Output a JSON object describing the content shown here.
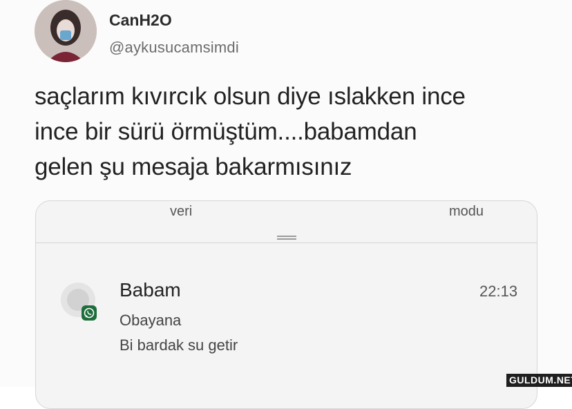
{
  "tweet": {
    "display_name": "CanH2O",
    "handle": "@aykusucamsimdi",
    "text_lines": [
      "saçlarım kıvırcık olsun diye ıslakken ince",
      "ince bir sürü örmüştüm....babamdan",
      "gelen şu mesaja bakarmısınız"
    ]
  },
  "notification_panel": {
    "tab_left": "veri",
    "tab_right": "modu",
    "notification": {
      "sender": "Babam",
      "time": "22:13",
      "app_icon": "whatsapp-icon",
      "message_lines": [
        "Obayana",
        "Bi bardak su getir"
      ]
    }
  },
  "watermark": "GULDUM.NET",
  "colors": {
    "background": "#fbfbfb",
    "text": "#222222",
    "handle": "#6c6c6c",
    "whatsapp_badge": "#1e6e3c"
  }
}
